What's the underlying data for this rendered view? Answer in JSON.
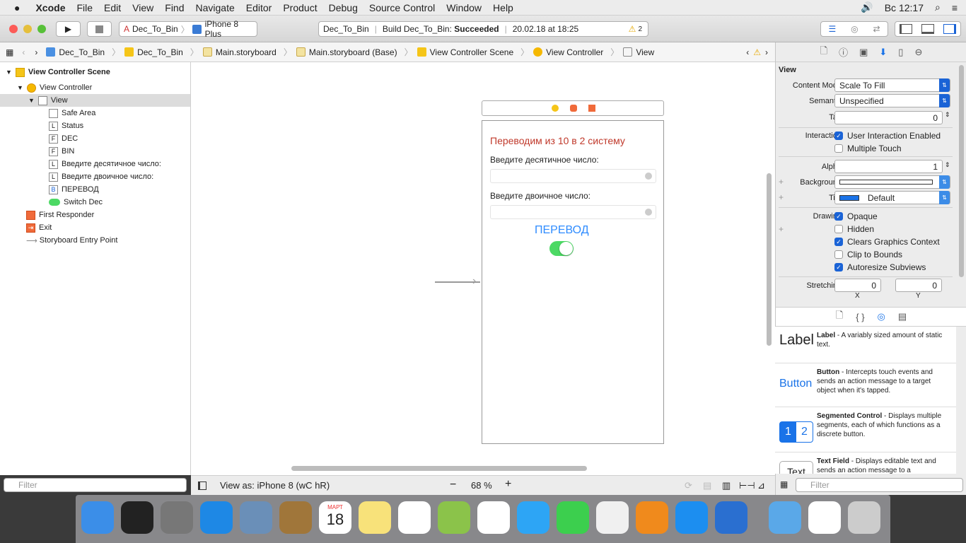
{
  "menubar": {
    "app": "Xcode",
    "items": [
      "File",
      "Edit",
      "View",
      "Find",
      "Navigate",
      "Editor",
      "Product",
      "Debug",
      "Source Control",
      "Window",
      "Help"
    ],
    "clock": "Вс 12:17"
  },
  "toolbar": {
    "scheme": "Dec_To_Bin",
    "device": "iPhone 8 Plus",
    "activity_project": "Dec_To_Bin",
    "activity_build": "Build Dec_To_Bin:",
    "activity_status": "Succeeded",
    "activity_time": "20.02.18 at 18:25",
    "warnings": "2"
  },
  "jumpbar": [
    "Dec_To_Bin",
    "Dec_To_Bin",
    "Main.storyboard",
    "Main.storyboard (Base)",
    "View Controller Scene",
    "View Controller",
    "View"
  ],
  "outline": {
    "scene": "View Controller Scene",
    "controller": "View Controller",
    "view": "View",
    "children": [
      {
        "icon": "safe-area",
        "badge": "",
        "label": "Safe Area"
      },
      {
        "icon": "label",
        "badge": "L",
        "label": "Status"
      },
      {
        "icon": "field",
        "badge": "F",
        "label": "DEC"
      },
      {
        "icon": "field",
        "badge": "F",
        "label": "BIN"
      },
      {
        "icon": "label",
        "badge": "L",
        "label": "Введите десятичное число:"
      },
      {
        "icon": "label",
        "badge": "L",
        "label": "Введите двоичное число:"
      },
      {
        "icon": "button",
        "badge": "B",
        "label": "ПЕРЕВОД"
      },
      {
        "icon": "switch",
        "badge": "",
        "label": "Switch Dec"
      }
    ],
    "first_responder": "First Responder",
    "exit": "Exit",
    "entry": "Storyboard Entry Point",
    "filter_placeholder": "Filter"
  },
  "phone": {
    "title": "Переводим из 10 в 2 систему",
    "dec_label": "Введите десятичное число:",
    "bin_label": "Введите двоичное число:",
    "button": "ПЕРЕВОД",
    "switch_on": true,
    "title_color": "#c0392b",
    "button_color": "#2f8cff"
  },
  "bottombar": {
    "view_as": "View as: iPhone 8 (",
    "wc": "wC",
    "hr": "hR",
    "close": ")",
    "zoom": "68 %"
  },
  "inspector": {
    "section": "View",
    "content_mode_label": "Content Mode",
    "content_mode": "Scale To Fill",
    "semantic_label": "Semantic",
    "semantic": "Unspecified",
    "tag_label": "Tag",
    "tag": "0",
    "interaction_label": "Interaction",
    "user_interaction": {
      "label": "User Interaction Enabled",
      "checked": true
    },
    "multiple_touch": {
      "label": "Multiple Touch",
      "checked": false
    },
    "alpha_label": "Alpha",
    "alpha": "1",
    "background_label": "Background",
    "tint_label": "Tint",
    "tint": "Default",
    "tint_color": "#1a73e8",
    "drawing_label": "Drawing",
    "drawing": [
      {
        "label": "Opaque",
        "checked": true
      },
      {
        "label": "Hidden",
        "checked": false
      },
      {
        "label": "Clears Graphics Context",
        "checked": true
      },
      {
        "label": "Clip to Bounds",
        "checked": false
      },
      {
        "label": "Autoresize Subviews",
        "checked": true
      }
    ],
    "stretching_label": "Stretching",
    "stretch_x": "0",
    "stretch_y": "0",
    "x_label": "X",
    "y_label": "Y"
  },
  "library": {
    "items": [
      {
        "preview": "Label",
        "name": "Label",
        "desc": " - A variably sized amount of static text."
      },
      {
        "preview": "Button",
        "name": "Button",
        "desc": " - Intercepts touch events and sends an action message to a target object when it's tapped."
      },
      {
        "preview": "12",
        "name": "Segmented Control",
        "desc": " - Displays multiple segments, each of which functions as a discrete button."
      },
      {
        "preview": "Text",
        "name": "Text Field",
        "desc": " - Displays editable text and sends an action message to a"
      }
    ],
    "filter_placeholder": "Filter"
  },
  "dock": [
    "Finder",
    "Siri",
    "Launchpad",
    "Safari",
    "Mail",
    "Contacts",
    "Calendar",
    "Notes",
    "Reminders",
    "Maps",
    "Photos",
    "Messages",
    "FaceTime",
    "iTunes",
    "iBooks",
    "App Store",
    "Xcode",
    "Downloads",
    "Preview",
    "Trash"
  ],
  "calendar": {
    "month": "МАРТ",
    "day": "18"
  }
}
